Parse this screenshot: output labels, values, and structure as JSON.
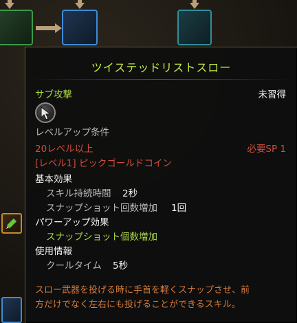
{
  "tooltip": {
    "title": "ツイステッドリストスロー",
    "category": "サブ攻撃",
    "status": "未習得",
    "levelup_header": "レベルアップ条件",
    "req_level": "20レベル以上",
    "req_sp": "必要SP 1",
    "req_item": "[レベル1] ピックゴールドコイン",
    "basic_effect_header": "基本効果",
    "effects": [
      {
        "label": "スキル持続時間",
        "value": "2秒"
      },
      {
        "label": "スナップショット回数増加",
        "value": "1回"
      }
    ],
    "powerup_header": "パワーアップ効果",
    "powerup_item": "スナップショット個数増加",
    "usage_header": "使用情報",
    "cooldown_label": "クールタイム",
    "cooldown_value": "5秒",
    "description": [
      "スロー武器を投げる時に手首を軽くスナップさせ、前",
      "方だけでなく左右にも投げることができるスキル。"
    ]
  },
  "icons": {
    "skill_icon": "cursor-arrow-icon",
    "pencil": "pencil-icon"
  },
  "colors": {
    "title": "#c6ee4a",
    "category": "#a8d64a",
    "requirement": "#d24b3c",
    "description": "#d67a3a"
  }
}
